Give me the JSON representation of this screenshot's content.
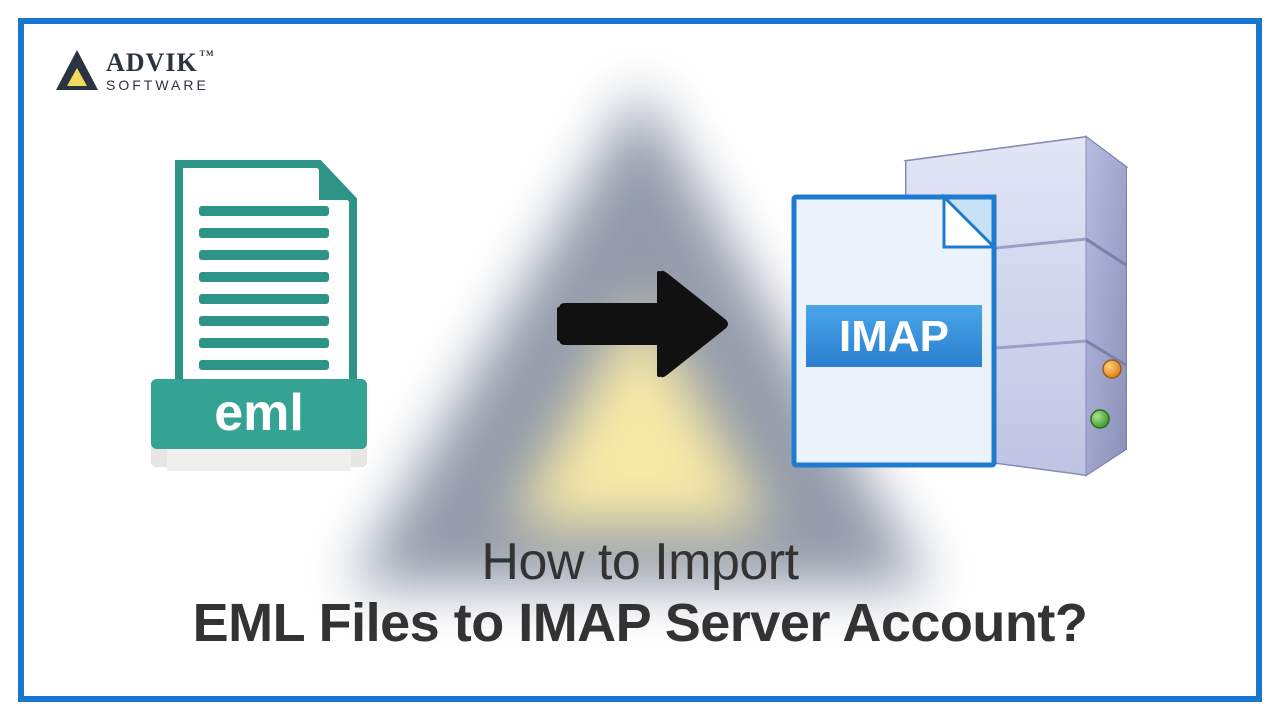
{
  "logo": {
    "brand": "ADVIK",
    "tm": "TM",
    "sub": "SOFTWARE"
  },
  "eml": {
    "label": "eml"
  },
  "imap": {
    "label": "IMAP"
  },
  "headline": {
    "line1": "How to Import",
    "line2": "EML Files to IMAP Server Account?"
  }
}
